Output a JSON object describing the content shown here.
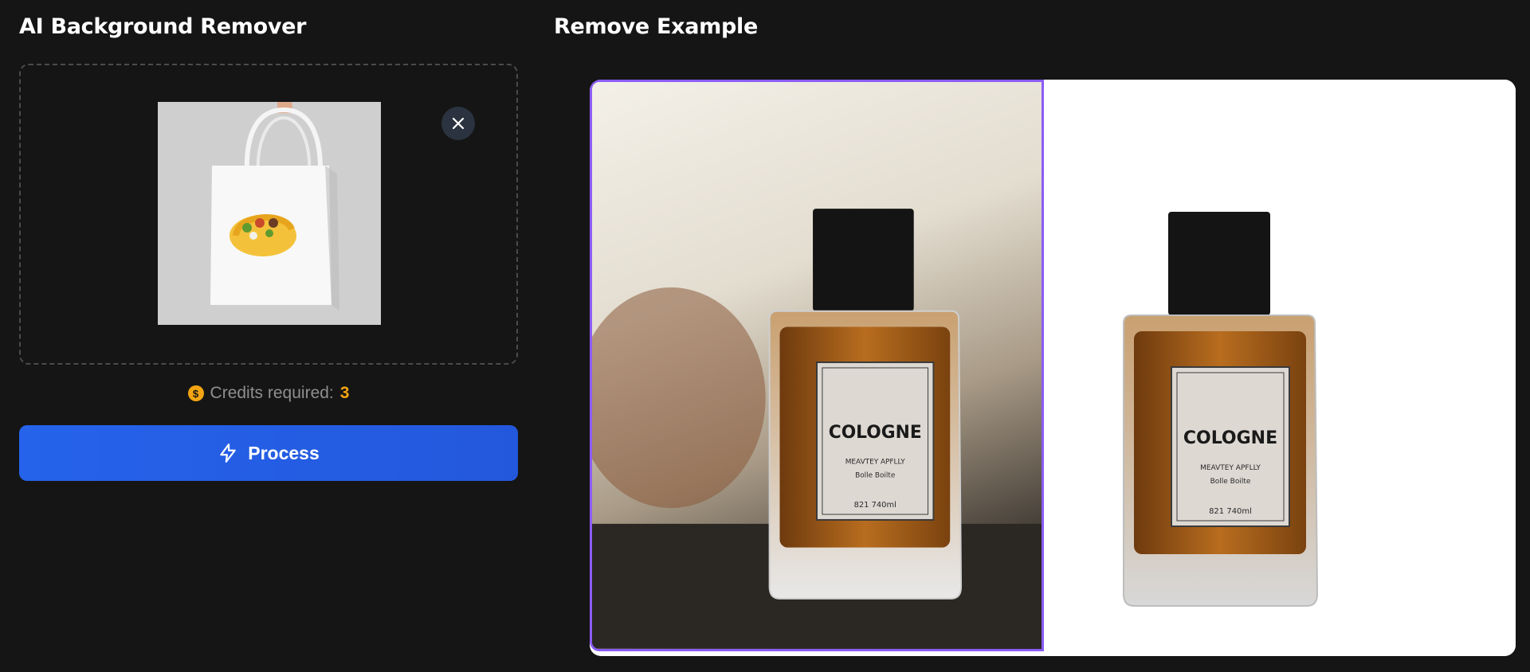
{
  "uploader": {
    "title": "AI Background Remover",
    "credits_label": "Credits required:",
    "credits_value": "3",
    "coin_symbol": "$",
    "process_label": "Process",
    "close_icon": "close-icon",
    "process_icon": "lightning-icon"
  },
  "example": {
    "title": "Remove Example",
    "bottle": {
      "brand": "COLOGNE",
      "line1": "MEAVTEY APFLLY",
      "line2": "Bolle Boilte",
      "volume": "821 740ml"
    }
  },
  "colors": {
    "accent": "#2563eb",
    "credit": "#f2a413",
    "compare_border": "#8b5cf6",
    "background": "#151515"
  }
}
